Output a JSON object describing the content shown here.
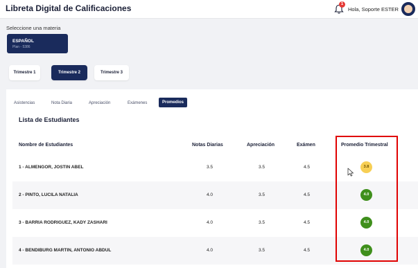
{
  "header": {
    "title": "Libreta Digital de Calificaciones",
    "notification_count": "1",
    "greeting": "Hola, Soporte ESTER"
  },
  "subject_selector": {
    "label": "Seleccione una materia",
    "selected": {
      "name": "ESPAÑOL",
      "plan": "Plan - 5386"
    }
  },
  "trimesters": [
    {
      "label": "Trimestre 1",
      "active": false
    },
    {
      "label": "Trimestre 2",
      "active": true
    },
    {
      "label": "Trimestre 3",
      "active": false
    }
  ],
  "tabs": [
    {
      "label": "Asistencias",
      "active": false
    },
    {
      "label": "Nota Diaria",
      "active": false
    },
    {
      "label": "Apreciación",
      "active": false
    },
    {
      "label": "Exámenes",
      "active": false
    },
    {
      "label": "Promedios",
      "active": true
    }
  ],
  "list": {
    "title": "Lista de Estudiantes",
    "columns": [
      "Nombre de Estudiantes",
      "Notas Diarias",
      "Apreciación",
      "Exámen",
      "Promedio Trimestral"
    ],
    "rows": [
      {
        "name": "1 - ALMENGOR, JOSTIN ABEL",
        "notas_diarias": "3.5",
        "apreciacion": "3.5",
        "examen": "4.5",
        "promedio": "3.8",
        "status": "warning"
      },
      {
        "name": "2 - PINTO, LUCILA NATALIA",
        "notas_diarias": "4.0",
        "apreciacion": "3.5",
        "examen": "4.5",
        "promedio": "4.0",
        "status": "ok"
      },
      {
        "name": "3 - BARRIA RODRIGUEZ, KADY ZASHARI",
        "notas_diarias": "4.0",
        "apreciacion": "3.5",
        "examen": "4.5",
        "promedio": "4.0",
        "status": "ok"
      },
      {
        "name": "4 - BENDIBURG MARTIN, ANTONIO ABDUL",
        "notas_diarias": "4.0",
        "apreciacion": "3.5",
        "examen": "4.5",
        "promedio": "4.0",
        "status": "ok"
      }
    ]
  },
  "colors": {
    "primary": "#1a2b5c",
    "badge_warning": "#f7cf55",
    "badge_ok": "#3f8f1c",
    "highlight": "#e00000"
  },
  "icons": {
    "notification": "bell-icon",
    "user": "avatar",
    "pointer": "mouse-cursor-icon"
  }
}
